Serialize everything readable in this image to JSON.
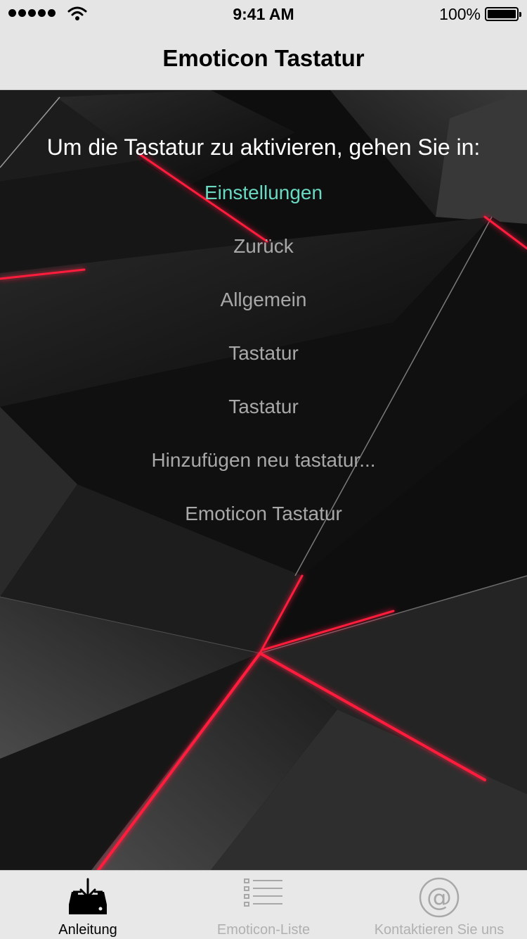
{
  "status_bar": {
    "time": "9:41 AM",
    "battery_percent": "100%",
    "signal_icon": "signal-dots-icon",
    "wifi_icon": "wifi-icon",
    "battery_icon": "battery-icon"
  },
  "nav": {
    "title": "Emoticon Tastatur"
  },
  "instructions": {
    "intro": "Um die Tastatur zu aktivieren, gehen Sie in:",
    "steps": [
      "Einstellungen",
      "Zurück",
      "Allgemein",
      "Tastatur",
      "Tastatur",
      "Hinzufügen neu tastatur...",
      "Emoticon Tastatur"
    ],
    "active_step_color": "#69d9c2",
    "step_color": "#a8a8a8"
  },
  "tab_bar": {
    "tabs": [
      {
        "label": "Anleitung",
        "icon": "download-tray-icon",
        "selected": true
      },
      {
        "label": "Emoticon-Liste",
        "icon": "list-icon",
        "selected": false
      },
      {
        "label": "Kontaktieren Sie uns",
        "icon": "at-sign-icon",
        "selected": false
      }
    ]
  },
  "colors": {
    "bar_background": "#e5e5e5",
    "accent_red": "#ff1a3c"
  }
}
